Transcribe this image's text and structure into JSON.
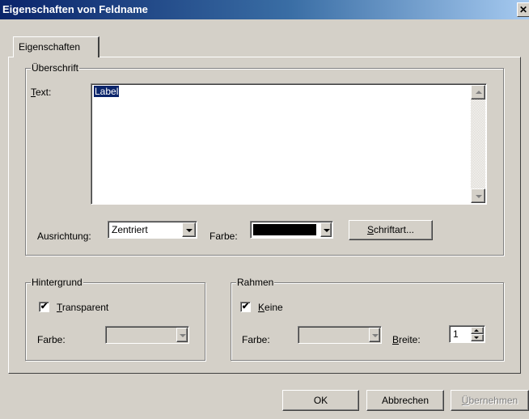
{
  "window": {
    "title": "Eigenschaften von Feldname",
    "close_glyph": "✕"
  },
  "tab": {
    "label": "Eigenschaften"
  },
  "caption_group": {
    "legend": "Überschrift",
    "text_label_underline": "T",
    "text_label_rest": "ext:",
    "text_value": "Label",
    "alignment_label": "Ausrichtung:",
    "alignment_value": "Zentriert",
    "color_label": "Farbe:",
    "color_value": "#000000",
    "font_button_underline": "S",
    "font_button_rest": "chriftart..."
  },
  "background_group": {
    "legend": "Hintergrund",
    "transparent_checked": true,
    "transparent_underline": "T",
    "transparent_rest": "ransparent",
    "color_label": "Farbe:"
  },
  "border_group": {
    "legend": "Rahmen",
    "none_checked": true,
    "none_underline": "K",
    "none_rest": "eine",
    "color_label": "Farbe:",
    "width_label_underline": "B",
    "width_label_rest": "reite:",
    "width_value": "1"
  },
  "buttons": {
    "ok": "OK",
    "cancel": "Abbrechen",
    "apply_underline": "Ü",
    "apply_rest": "bernehmen"
  }
}
